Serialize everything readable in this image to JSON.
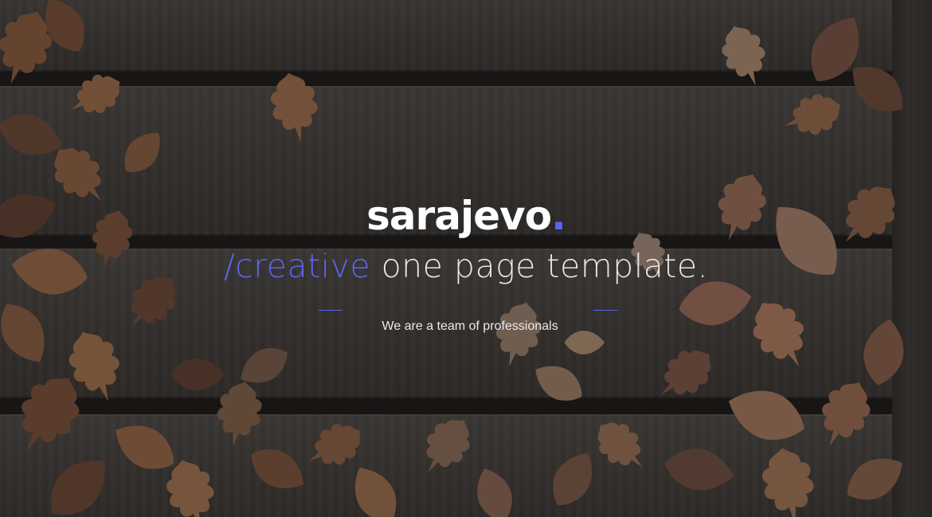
{
  "hero": {
    "brand_name": "sarajevo",
    "brand_dot": ".",
    "tagline_accent": "/creative",
    "tagline_rest": " one page template.",
    "subtitle": "We are a team of professionals"
  },
  "colors": {
    "accent": "#5b66f0",
    "text": "#ffffff",
    "overlay": "#1e1c1c"
  }
}
